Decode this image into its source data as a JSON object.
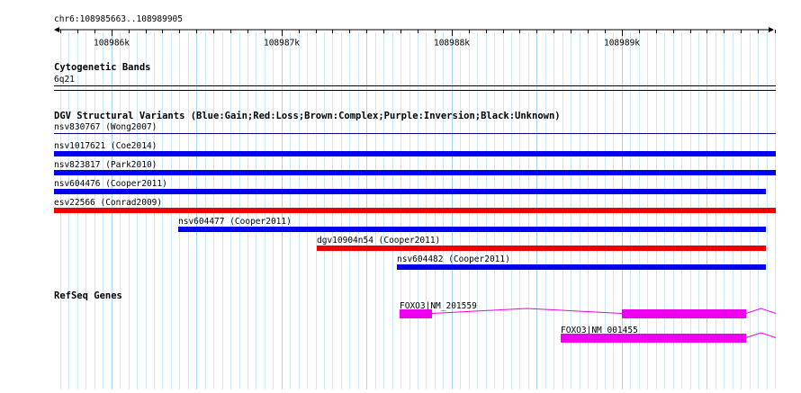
{
  "ruler": {
    "location": "chr6:108985663..108989905",
    "ticks": [
      {
        "label": "108986k",
        "pos": 108986000
      },
      {
        "label": "108987k",
        "pos": 108987000
      },
      {
        "label": "108988k",
        "pos": 108988000
      },
      {
        "label": "108989k",
        "pos": 108989000
      }
    ]
  },
  "cytoband_track": {
    "title": "Cytogenetic Bands",
    "band": "6q21"
  },
  "dgv_track": {
    "title": "DGV Structural Variants (Blue:Gain;Red:Loss;Brown:Complex;Purple:Inversion;Black:Unknown)",
    "colors": {
      "gain": "#0000ee",
      "loss": "#ee0000",
      "outline": "#000080"
    },
    "features": [
      {
        "label": "nsv830767 (Wong2007)",
        "type": "thin",
        "clipped": true
      },
      {
        "label": "nsv1017621 (Coe2014)",
        "type": "gain",
        "clipped": true
      },
      {
        "label": "nsv823817 (Park2010)",
        "type": "gain",
        "clipped": true
      },
      {
        "label": "nsv604476 (Cooper2011)",
        "type": "gain",
        "end": 108989845
      },
      {
        "label": "esv22566 (Conrad2009)",
        "type": "loss",
        "clipped": true
      },
      {
        "label": "nsv604477 (Cooper2011)",
        "type": "gain",
        "start": 108986393,
        "end": 108989845
      },
      {
        "label": "dgv10904n54 (Cooper2011)",
        "type": "loss",
        "start": 108987209,
        "end": 108989845
      },
      {
        "label": "nsv604482 (Cooper2011)",
        "type": "gain",
        "start": 108987680,
        "end": 108989845
      }
    ]
  },
  "refseq_track": {
    "title": "RefSeq Genes",
    "color": "#ee00ee",
    "genes": [
      {
        "label": "FOXO3|NM_201559",
        "exons": [
          [
            108987695,
            108987885
          ],
          [
            108989000,
            108989730
          ]
        ],
        "intron_end": 108989905
      },
      {
        "label": "FOXO3|NM_001455",
        "exons": [
          [
            108988640,
            108989730
          ]
        ],
        "intron_end": 108989905
      }
    ]
  }
}
